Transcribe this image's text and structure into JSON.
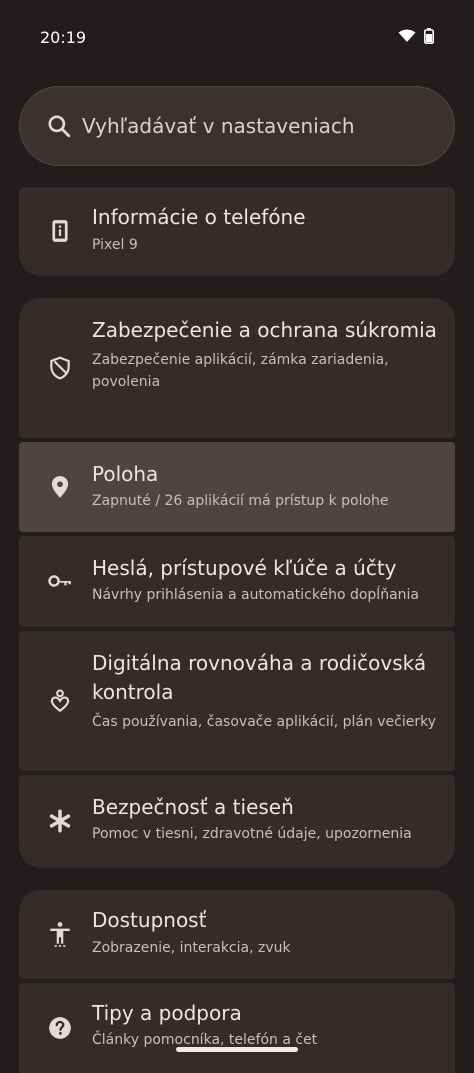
{
  "status": {
    "time": "20:19"
  },
  "search": {
    "placeholder": "Vyhľadávať v nastaveniach"
  },
  "items": [
    {
      "title": "Informácie o telefóne",
      "subtitle": "Pixel 9",
      "icon": "phone-info-icon"
    },
    {
      "title": "Zabezpečenie a ochrana súkromia",
      "subtitle": "Zabezpečenie aplikácií, zámka zariadenia, povolenia",
      "icon": "shield-icon"
    },
    {
      "title": "Poloha",
      "subtitle": "Zapnuté / 26 aplikácií má prístup k polohe",
      "icon": "location-pin-icon"
    },
    {
      "title": "Heslá, prístupové kľúče a účty",
      "subtitle": "Návrhy prihlásenia a automatického dopĺňania",
      "icon": "key-icon"
    },
    {
      "title": "Digitálna rovnováha a rodičovská kontrola",
      "subtitle": "Čas používania, časovače aplikácií, plán večierky",
      "icon": "wellbeing-heart-icon"
    },
    {
      "title": "Bezpečnosť a tieseň",
      "subtitle": "Pomoc v tiesni, zdravotné údaje, upozornenia",
      "icon": "asterisk-icon"
    },
    {
      "title": "Dostupnosť",
      "subtitle": "Zobrazenie, interakcia, zvuk",
      "icon": "accessibility-icon"
    },
    {
      "title": "Tipy a podpora",
      "subtitle": "Články pomocníka, telefón a čet",
      "icon": "help-icon"
    }
  ],
  "colors": {
    "background": "#221d1c",
    "card": "#332c2a",
    "selected": "#4e4543"
  }
}
